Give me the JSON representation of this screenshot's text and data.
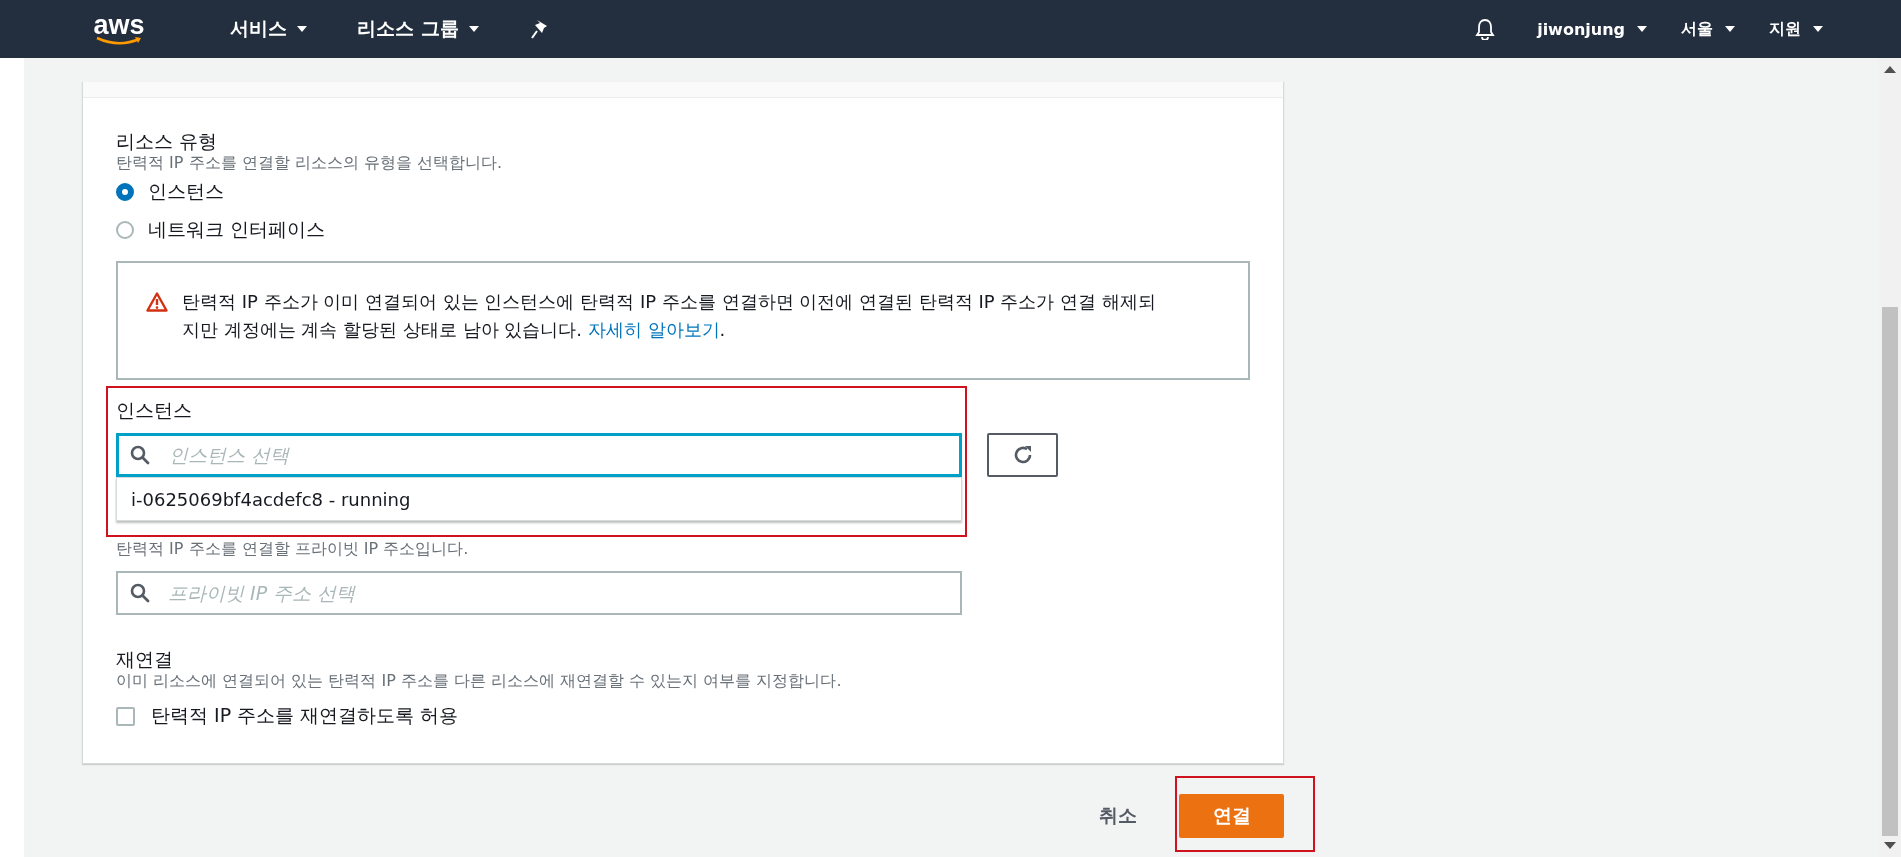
{
  "nav": {
    "logo": "aws",
    "menus": [
      {
        "label": "서비스"
      },
      {
        "label": "리소스 그룹"
      }
    ],
    "right": [
      {
        "label": "jiwonjung"
      },
      {
        "label": "서울"
      },
      {
        "label": "지원"
      }
    ]
  },
  "resource_type": {
    "label": "리소스 유형",
    "description": "탄력적 IP 주소를 연결할 리소스의 유형을 선택합니다.",
    "options": [
      {
        "label": "인스턴스",
        "selected": true
      },
      {
        "label": "네트워크 인터페이스",
        "selected": false
      }
    ]
  },
  "warning": {
    "text": "탄력적 IP 주소가 이미 연결되어 있는 인스턴스에 탄력적 IP 주소를 연결하면 이전에 연결된 탄력적 IP 주소가 연결 해제되지만 계정에는 계속 할당된 상태로 남아 있습니다. ",
    "link": "자세히 알아보기",
    "suffix": "."
  },
  "instance": {
    "label": "인스턴스",
    "placeholder": "인스턴스 선택",
    "options": [
      {
        "label": "i-0625069bf4acdefc8 - running"
      }
    ]
  },
  "private_ip": {
    "description": "탄력적 IP 주소를 연결할 프라이빗 IP 주소입니다.",
    "placeholder": "프라이빗 IP 주소 선택"
  },
  "reassociation": {
    "label": "재연결",
    "description": "이미 리소스에 연결되어 있는 탄력적 IP 주소를 다른 리소스에 재연결할 수 있는지 여부를 지정합니다.",
    "checkbox": {
      "label": "탄력적 IP 주소를 재연결하도록 허용",
      "checked": false
    }
  },
  "buttons": {
    "cancel": "취소",
    "submit": "연결"
  }
}
